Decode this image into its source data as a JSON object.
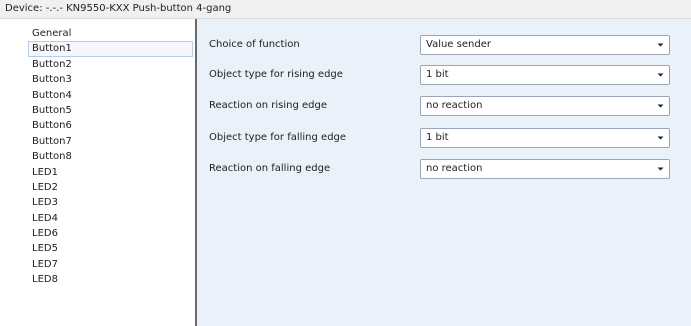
{
  "window": {
    "title": "Device: -.-.-  KN9550-KXX Push-button 4-gang"
  },
  "sidebar": {
    "items": [
      {
        "label": "General"
      },
      {
        "label": "Button1",
        "selected": true
      },
      {
        "label": "Button2"
      },
      {
        "label": "Button3"
      },
      {
        "label": "Button4"
      },
      {
        "label": "Button5"
      },
      {
        "label": "Button6"
      },
      {
        "label": "Button7"
      },
      {
        "label": "Button8"
      },
      {
        "label": "LED1"
      },
      {
        "label": "LED2"
      },
      {
        "label": "LED3"
      },
      {
        "label": "LED4"
      },
      {
        "label": "LED6"
      },
      {
        "label": "LED5"
      },
      {
        "label": "LED7"
      },
      {
        "label": "LED8"
      }
    ]
  },
  "parameters": [
    {
      "label": "Choice of function",
      "value": "Value sender"
    },
    {
      "label": "Object type for rising edge",
      "value": "1 bit"
    },
    {
      "label": "Reaction on rising edge",
      "value": "no reaction"
    },
    {
      "label": "Object type for falling edge",
      "value": "1 bit"
    },
    {
      "label": "Reaction on falling edge",
      "value": "no reaction"
    }
  ],
  "icons": {
    "dropdown": "chevron-down-icon"
  },
  "colors": {
    "content_background": "#eaf1f8",
    "selection_border": "#b9cbe6",
    "splitter": "#6a6a6a"
  }
}
